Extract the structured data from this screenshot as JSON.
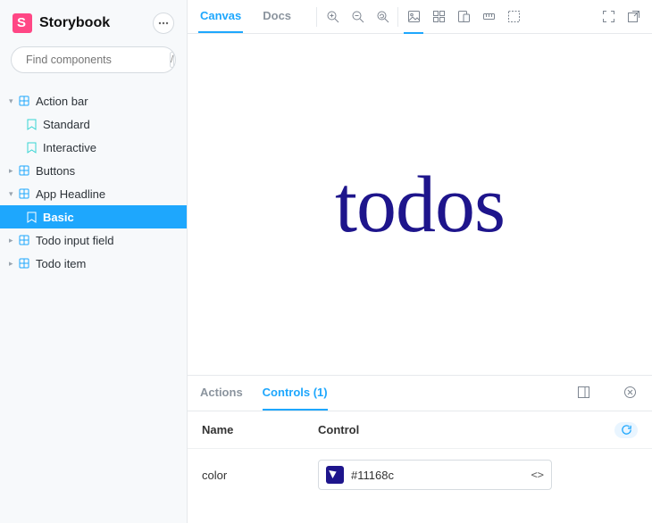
{
  "brand": {
    "title": "Storybook"
  },
  "search": {
    "placeholder": "Find components",
    "shortcut": "/"
  },
  "sidebar": {
    "items": [
      {
        "label": "Action bar",
        "kind": "component",
        "expanded": true
      },
      {
        "label": "Standard",
        "kind": "story"
      },
      {
        "label": "Interactive",
        "kind": "story"
      },
      {
        "label": "Buttons",
        "kind": "component",
        "expanded": false
      },
      {
        "label": "App Headline",
        "kind": "component",
        "expanded": true
      },
      {
        "label": "Basic",
        "kind": "story",
        "selected": true
      },
      {
        "label": "Todo input field",
        "kind": "component",
        "expanded": false
      },
      {
        "label": "Todo item",
        "kind": "component",
        "expanded": false
      }
    ]
  },
  "toolbar": {
    "tabs": [
      {
        "label": "Canvas",
        "active": true
      },
      {
        "label": "Docs",
        "active": false
      }
    ]
  },
  "preview": {
    "text": "todos",
    "color": "#1e158c"
  },
  "panel": {
    "tabs": [
      {
        "label": "Actions",
        "active": false
      },
      {
        "label": "Controls (1)",
        "active": true
      }
    ],
    "columns": {
      "name": "Name",
      "control": "Control"
    },
    "rows": [
      {
        "name": "color",
        "value": "#11168c"
      }
    ]
  }
}
